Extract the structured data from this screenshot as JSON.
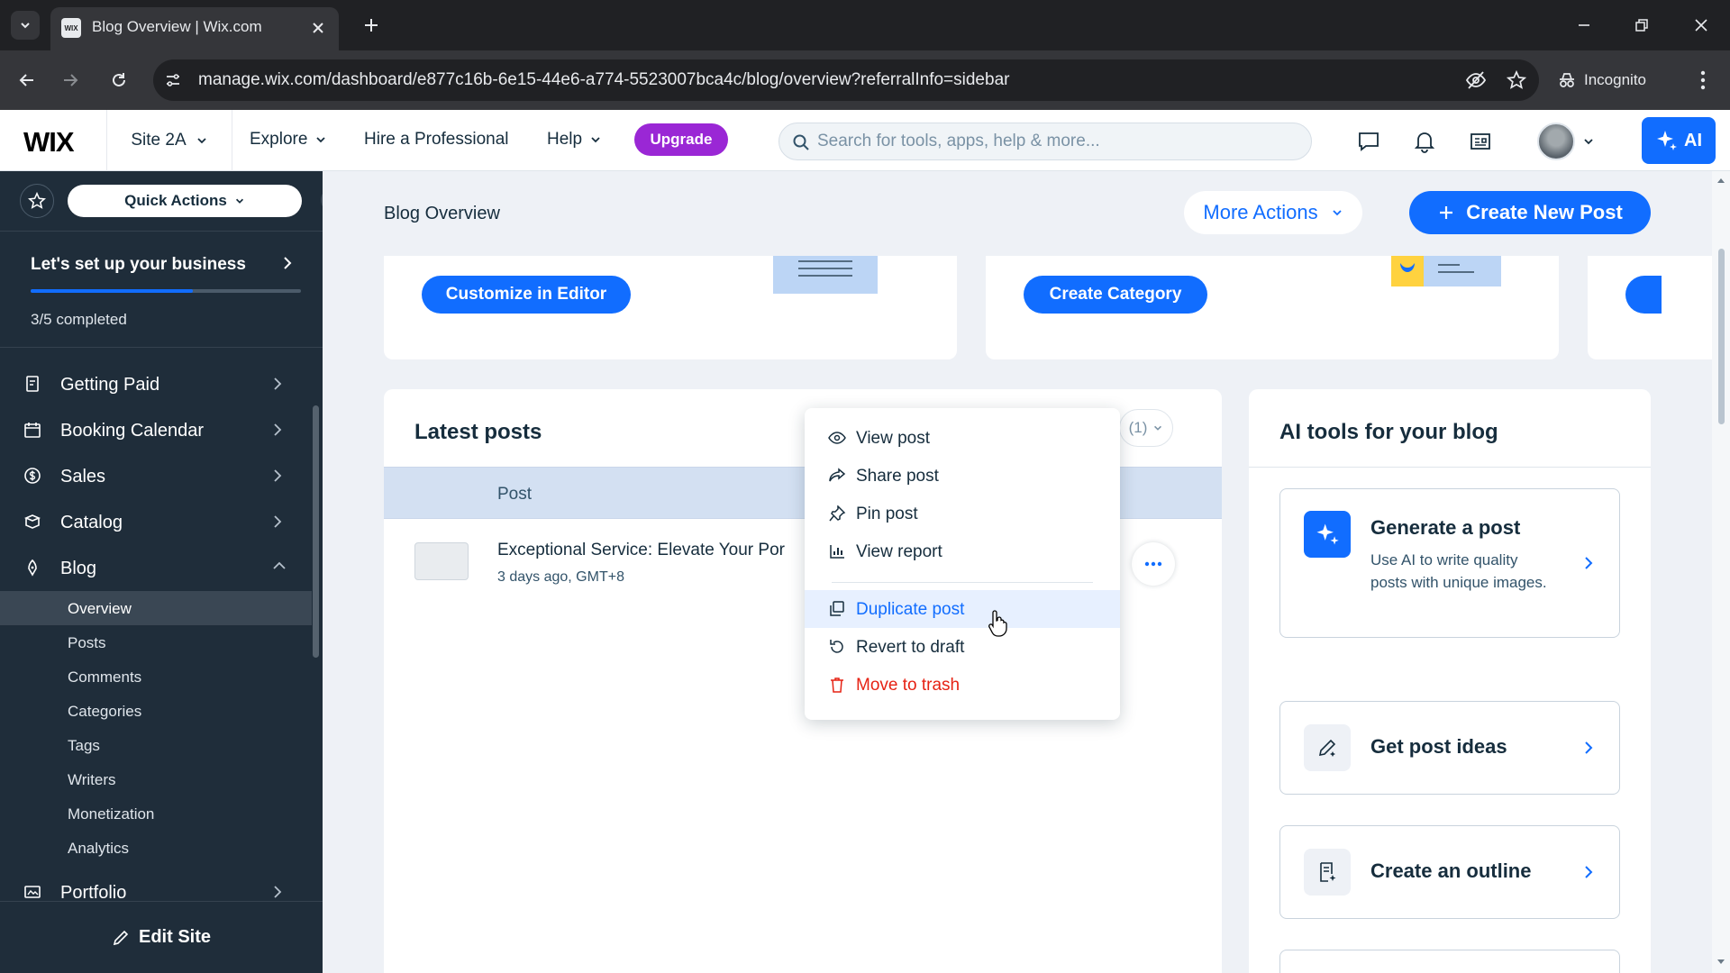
{
  "browser": {
    "tab_title": "Blog Overview | Wix.com",
    "favicon_text": "WIX",
    "url": "manage.wix.com/dashboard/e877c16b-6e15-44e6-a774-5523007bca4c/blog/overview?referralInfo=sidebar",
    "incognito_label": "Incognito"
  },
  "topbar": {
    "logo": "WIX",
    "site_name": "Site 2A",
    "explore": "Explore",
    "hire": "Hire a Professional",
    "help": "Help",
    "upgrade": "Upgrade",
    "search_placeholder": "Search for tools, apps, help & more...",
    "ai_label": "AI"
  },
  "sidebar": {
    "quick_actions": "Quick Actions",
    "setup_title": "Let's set up your business",
    "setup_progress": "3/5 completed",
    "setup_fraction": 0.6,
    "items": [
      {
        "label": "Getting Paid",
        "icon": "getting-paid-icon"
      },
      {
        "label": "Booking Calendar",
        "icon": "calendar-icon"
      },
      {
        "label": "Sales",
        "icon": "sales-icon"
      },
      {
        "label": "Catalog",
        "icon": "catalog-icon"
      },
      {
        "label": "Blog",
        "icon": "blog-icon"
      }
    ],
    "blog_sub": [
      "Overview",
      "Posts",
      "Comments",
      "Categories",
      "Tags",
      "Writers",
      "Monetization",
      "Analytics"
    ],
    "portfolio": "Portfolio",
    "edit_site": "Edit Site"
  },
  "page": {
    "title": "Blog Overview",
    "more_actions": "More Actions",
    "create_new_post": "Create New Post",
    "customize_btn": "Customize in Editor",
    "category_btn": "Create Category"
  },
  "latest_posts": {
    "title": "Latest posts",
    "filter_label": "(1)",
    "column_post": "Post",
    "posts": [
      {
        "title": "Exceptional Service: Elevate Your Por",
        "date": "3 days ago, GMT+8"
      }
    ]
  },
  "post_menu": {
    "items": [
      {
        "label": "View post",
        "icon": "eye-icon"
      },
      {
        "label": "Share post",
        "icon": "share-icon"
      },
      {
        "label": "Pin post",
        "icon": "pin-icon"
      },
      {
        "label": "View report",
        "icon": "report-icon"
      },
      {
        "label": "Duplicate post",
        "icon": "duplicate-icon"
      },
      {
        "label": "Revert to draft",
        "icon": "revert-icon"
      },
      {
        "label": "Move to trash",
        "icon": "trash-icon"
      }
    ]
  },
  "ai_tools": {
    "title": "AI tools for your blog",
    "generate_title": "Generate a post",
    "generate_desc": "Use AI to write quality posts with unique images.",
    "ideas_title": "Get post ideas",
    "outline_title": "Create an outline"
  },
  "colors": {
    "accent": "#116dff",
    "upgrade": "#9a27d5",
    "sidebar": "#1f2d3a",
    "danger": "#e62214"
  }
}
